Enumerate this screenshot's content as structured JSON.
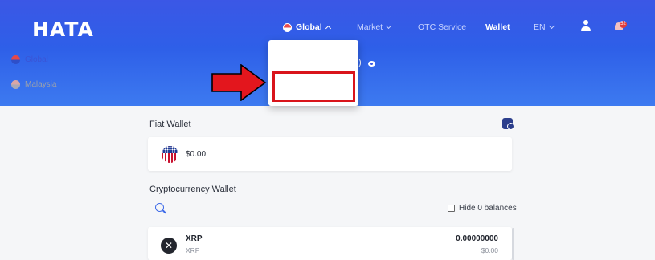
{
  "brand": {
    "logo": "HATA"
  },
  "nav": {
    "region": "Global",
    "market": "Market",
    "otc": "OTC Service",
    "wallet": "Wallet",
    "language": "EN"
  },
  "region_dropdown": {
    "options": [
      {
        "label": "Global"
      },
      {
        "label": "Malaysia"
      }
    ],
    "highlighted": "Malaysia"
  },
  "notifications": {
    "count": "52"
  },
  "fiat_wallet": {
    "title": "Fiat Wallet",
    "balance": "$0.00"
  },
  "crypto_wallet": {
    "title": "Cryptocurrency Wallet",
    "hide_zero_label": "Hide 0 balances",
    "assets": [
      {
        "symbol": "XRP",
        "name": "XRP",
        "balance": "0.00000000",
        "fiat": "$0.00",
        "icon": "x-icon"
      }
    ]
  },
  "colors": {
    "header": "#3b57e6",
    "annotation": "#d9141b",
    "accent": "#3d6ae8"
  }
}
